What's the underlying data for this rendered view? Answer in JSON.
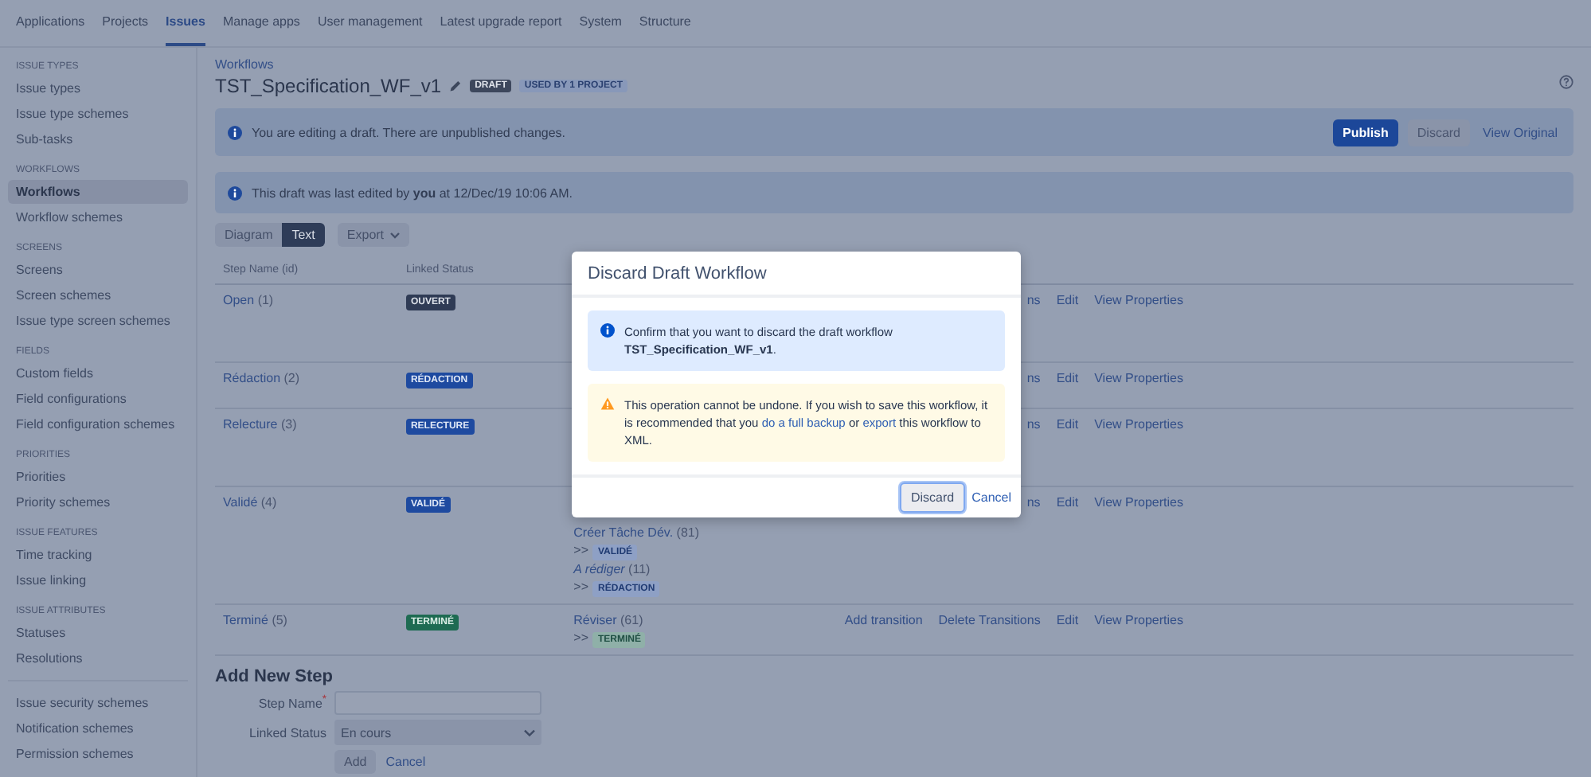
{
  "top_nav": [
    {
      "label": "Applications",
      "selected": false
    },
    {
      "label": "Projects",
      "selected": false
    },
    {
      "label": "Issues",
      "selected": true
    },
    {
      "label": "Manage apps",
      "selected": false
    },
    {
      "label": "User management",
      "selected": false
    },
    {
      "label": "Latest upgrade report",
      "selected": false
    },
    {
      "label": "System",
      "selected": false
    },
    {
      "label": "Structure",
      "selected": false
    }
  ],
  "sidebar": {
    "sections": [
      {
        "heading": "ISSUE TYPES",
        "items": [
          {
            "label": "Issue types",
            "selected": false
          },
          {
            "label": "Issue type schemes",
            "selected": false
          },
          {
            "label": "Sub-tasks",
            "selected": false
          }
        ]
      },
      {
        "heading": "WORKFLOWS",
        "items": [
          {
            "label": "Workflows",
            "selected": true
          },
          {
            "label": "Workflow schemes",
            "selected": false
          }
        ]
      },
      {
        "heading": "SCREENS",
        "items": [
          {
            "label": "Screens",
            "selected": false
          },
          {
            "label": "Screen schemes",
            "selected": false
          },
          {
            "label": "Issue type screen schemes",
            "selected": false
          }
        ]
      },
      {
        "heading": "FIELDS",
        "items": [
          {
            "label": "Custom fields",
            "selected": false
          },
          {
            "label": "Field configurations",
            "selected": false
          },
          {
            "label": "Field configuration schemes",
            "selected": false
          }
        ]
      },
      {
        "heading": "PRIORITIES",
        "items": [
          {
            "label": "Priorities",
            "selected": false
          },
          {
            "label": "Priority schemes",
            "selected": false
          }
        ]
      },
      {
        "heading": "ISSUE FEATURES",
        "items": [
          {
            "label": "Time tracking",
            "selected": false
          },
          {
            "label": "Issue linking",
            "selected": false
          }
        ]
      },
      {
        "heading": "ISSUE ATTRIBUTES",
        "items": [
          {
            "label": "Statuses",
            "selected": false
          },
          {
            "label": "Resolutions",
            "selected": false
          }
        ]
      },
      {
        "items": [
          {
            "label": "Issue security schemes",
            "selected": false
          },
          {
            "label": "Notification schemes",
            "selected": false
          },
          {
            "label": "Permission schemes",
            "selected": false
          }
        ]
      }
    ]
  },
  "breadcrumb": "Workflows",
  "title": "TST_Specification_WF_v1",
  "title_badges": [
    {
      "label": "DRAFT",
      "kind": "dark"
    },
    {
      "label": "USED BY 1 PROJECT",
      "kind": "light"
    }
  ],
  "draft_banner": {
    "message": "You are editing a draft. There are unpublished changes.",
    "buttons": [
      {
        "label": "Publish",
        "kind": "primary"
      },
      {
        "label": "Discard",
        "kind": "default"
      },
      {
        "label": "View Original",
        "kind": "link"
      }
    ]
  },
  "edited_banner": {
    "message": "This draft was last edited by **you** at 12/Dec/19 10:06 AM."
  },
  "view_tabs": [
    {
      "label": "Diagram",
      "selected": false
    },
    {
      "label": "Text",
      "selected": true
    }
  ],
  "export_button": "Export",
  "table": {
    "columns": [
      "Step Name (id)",
      "Linked Status"
    ],
    "rows": [
      {
        "step": "Open",
        "id": "(1)",
        "status": {
          "label": "OUVERT",
          "kind": "new"
        },
        "transitions": [],
        "actions": [
          "ns",
          "Edit",
          "View Properties"
        ]
      },
      {
        "step": "Rédaction",
        "id": "(2)",
        "status": {
          "label": "RÉDACTION",
          "kind": "progress"
        },
        "transitions": [],
        "actions": [
          "ns",
          "Edit",
          "View Properties"
        ]
      },
      {
        "step": "Relecture",
        "id": "(3)",
        "status": {
          "label": "RELECTURE",
          "kind": "progress"
        },
        "transitions": [],
        "actions": [
          "ns",
          "Edit",
          "View Properties"
        ]
      },
      {
        "step": "Validé",
        "id": "(4)",
        "status": {
          "label": "VALIDÉ",
          "kind": "progress"
        },
        "transitions": [
          {
            "name": "Créer Tâche Dév.",
            "italic": false,
            "id": "(81)",
            "arrow": ">>",
            "target": {
              "label": "VALIDÉ",
              "kind": "progress"
            }
          },
          {
            "name": "A rédiger",
            "italic": true,
            "id": "(11)",
            "arrow": ">>",
            "target": {
              "label": "RÉDACTION",
              "kind": "progress"
            }
          }
        ],
        "actions": [
          "ns",
          "Edit",
          "View Properties"
        ]
      },
      {
        "step": "Terminé",
        "id": "(5)",
        "status": {
          "label": "TERMINÉ",
          "kind": "done"
        },
        "transitions": [
          {
            "name": "Réviser",
            "italic": false,
            "id": "(61)",
            "arrow": ">>",
            "target": {
              "label": "TERMINÉ",
              "kind": "done"
            }
          }
        ],
        "actions": [
          "Add transition",
          "Delete Transitions",
          "Edit",
          "View Properties"
        ]
      }
    ]
  },
  "add_step": {
    "heading": "Add New Step",
    "step_name_label": "Step Name",
    "required_mark": "*",
    "linked_status_label": "Linked Status",
    "linked_status_value": "En cours",
    "add_button": "Add",
    "cancel_link": "Cancel"
  },
  "dialog": {
    "title": "Discard Draft Workflow",
    "info": "Confirm that you want to discard the draft workflow **TST_Specification_WF_v1**.",
    "warning": {
      "before": "This operation cannot be undone. If you wish to save this workflow, it is recommended that you",
      "link1": "do a full backup",
      "middle": "or",
      "link2": "export",
      "after": "this workflow to XML."
    },
    "confirm_button": "Discard",
    "cancel_link": "Cancel"
  }
}
